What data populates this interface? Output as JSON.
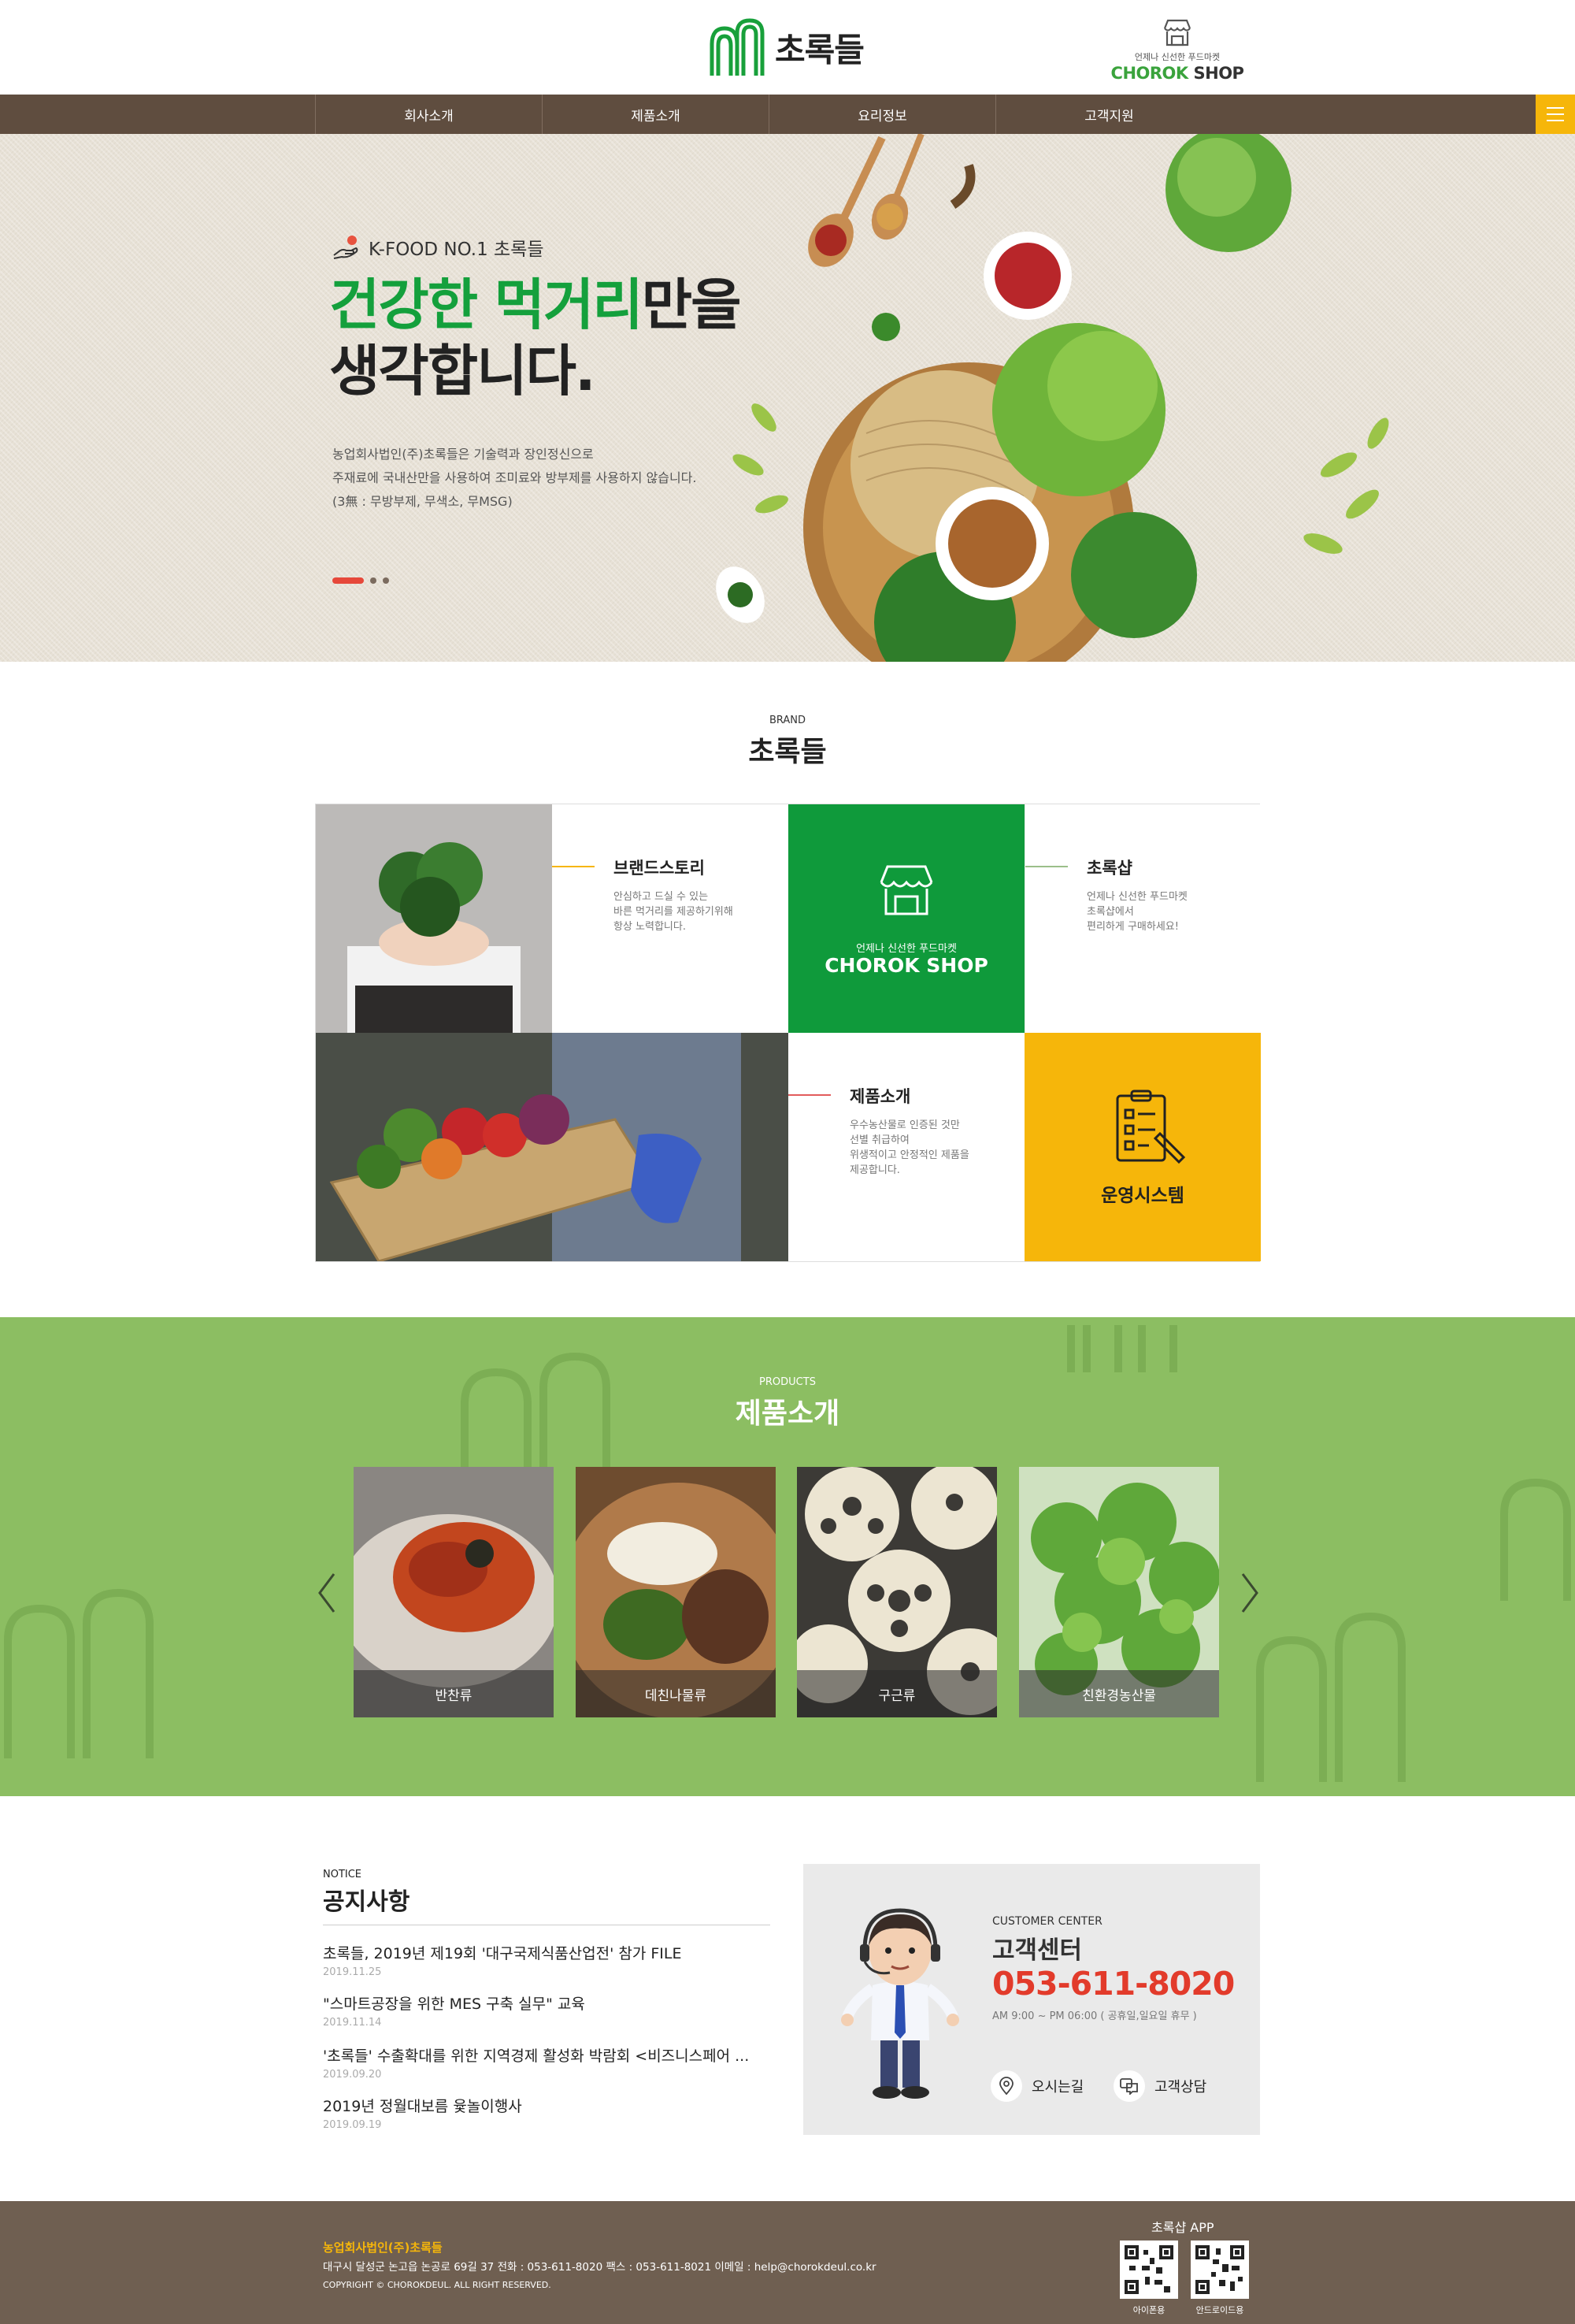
{
  "header": {
    "logo_text": "초록들",
    "shop_tagline": "언제나 신선한 푸드마켓",
    "shop_name_green": "CHOROK",
    "shop_name_dark": " SHOP"
  },
  "nav": {
    "items": [
      {
        "label": "회사소개"
      },
      {
        "label": "제품소개"
      },
      {
        "label": "요리정보"
      },
      {
        "label": "고객지원"
      }
    ]
  },
  "hero": {
    "badge": "K-FOOD NO.1 초록들",
    "title_green": "건강한 먹거리",
    "title_rest": "만을",
    "title_line2": "생각합니다.",
    "desc_lines": [
      "농업회사법인(주)초록들은 기술력과 장인정신으로",
      "주재료에 국내산만을 사용하여 조미료와 방부제를 사용하지 않습니다.",
      "(3無 : 무방부제, 무색소, 무MSG)"
    ],
    "slide_index": 1,
    "slide_count": 3
  },
  "brand": {
    "eyebrow": "BRAND",
    "title": "초록들",
    "story": {
      "title": "브랜드스토리",
      "desc": [
        "안심하고 드실 수 있는",
        "바른 먹거리를 제공하기위해",
        "항상 노력합니다."
      ]
    },
    "shop_tile": {
      "tagline": "언제나 신선한 푸드마켓",
      "name": "CHOROK SHOP"
    },
    "shop": {
      "title": "초록샵",
      "desc": [
        "언제나 신선한 푸드마켓",
        "초록샵에서",
        "편리하게 구매하세요!"
      ]
    },
    "products": {
      "title": "제품소개",
      "desc": [
        "우수농산물로 인증된 것만",
        "선별 취급하여",
        "위생적이고  안정적인 제품을",
        "제공합니다."
      ]
    },
    "system": {
      "title": "운영시스템"
    },
    "colors": {
      "green": "#0f9a3b",
      "yellow": "#f6b60a"
    }
  },
  "products": {
    "eyebrow": "PRODUCTS",
    "title": "제품소개",
    "items": [
      {
        "label": "반찬류"
      },
      {
        "label": "데친나물류"
      },
      {
        "label": "구근류"
      },
      {
        "label": "친환경농산물"
      }
    ]
  },
  "notice": {
    "eyebrow": "NOTICE",
    "title": "공지사항",
    "items": [
      {
        "title": "초록들, 2019년 제19회 '대구국제식품산업전' 참가  FILE",
        "date": "2019.11.25"
      },
      {
        "title": "\"스마트공장을 위한 MES 구축 실무\" 교육",
        "date": "2019.11.14"
      },
      {
        "title": "'초록들' 수출확대를 위한 지역경제 활성화 박람회 <비즈니스페어 ...",
        "date": "2019.09.20"
      },
      {
        "title": "2019년 정월대보름 윷놀이행사",
        "date": "2019.09.19"
      }
    ]
  },
  "customer": {
    "eyebrow": "CUSTOMER CENTER",
    "title": "고객센터",
    "phone": "053-611-8020",
    "hours": "AM 9:00 ~ PM 06:00 ( 공휴일,일요일 휴무 )",
    "directions": "오시는길",
    "consult": "고객상담"
  },
  "footer": {
    "company": "농업회사법인(주)초록들",
    "address": "대구시 달성군 논고읍 논공로 69길 37    전화 : 053-611-8020    팩스 : 053-611-8021    이메일 : help@chorokdeul.co.kr",
    "copyright": "COPYRIGHT © CHOROKDEUL. ALL RIGHT RESERVED.",
    "app_title": "초록샵 APP",
    "ios_label": "아이폰용",
    "android_label": "안드로이드용"
  }
}
